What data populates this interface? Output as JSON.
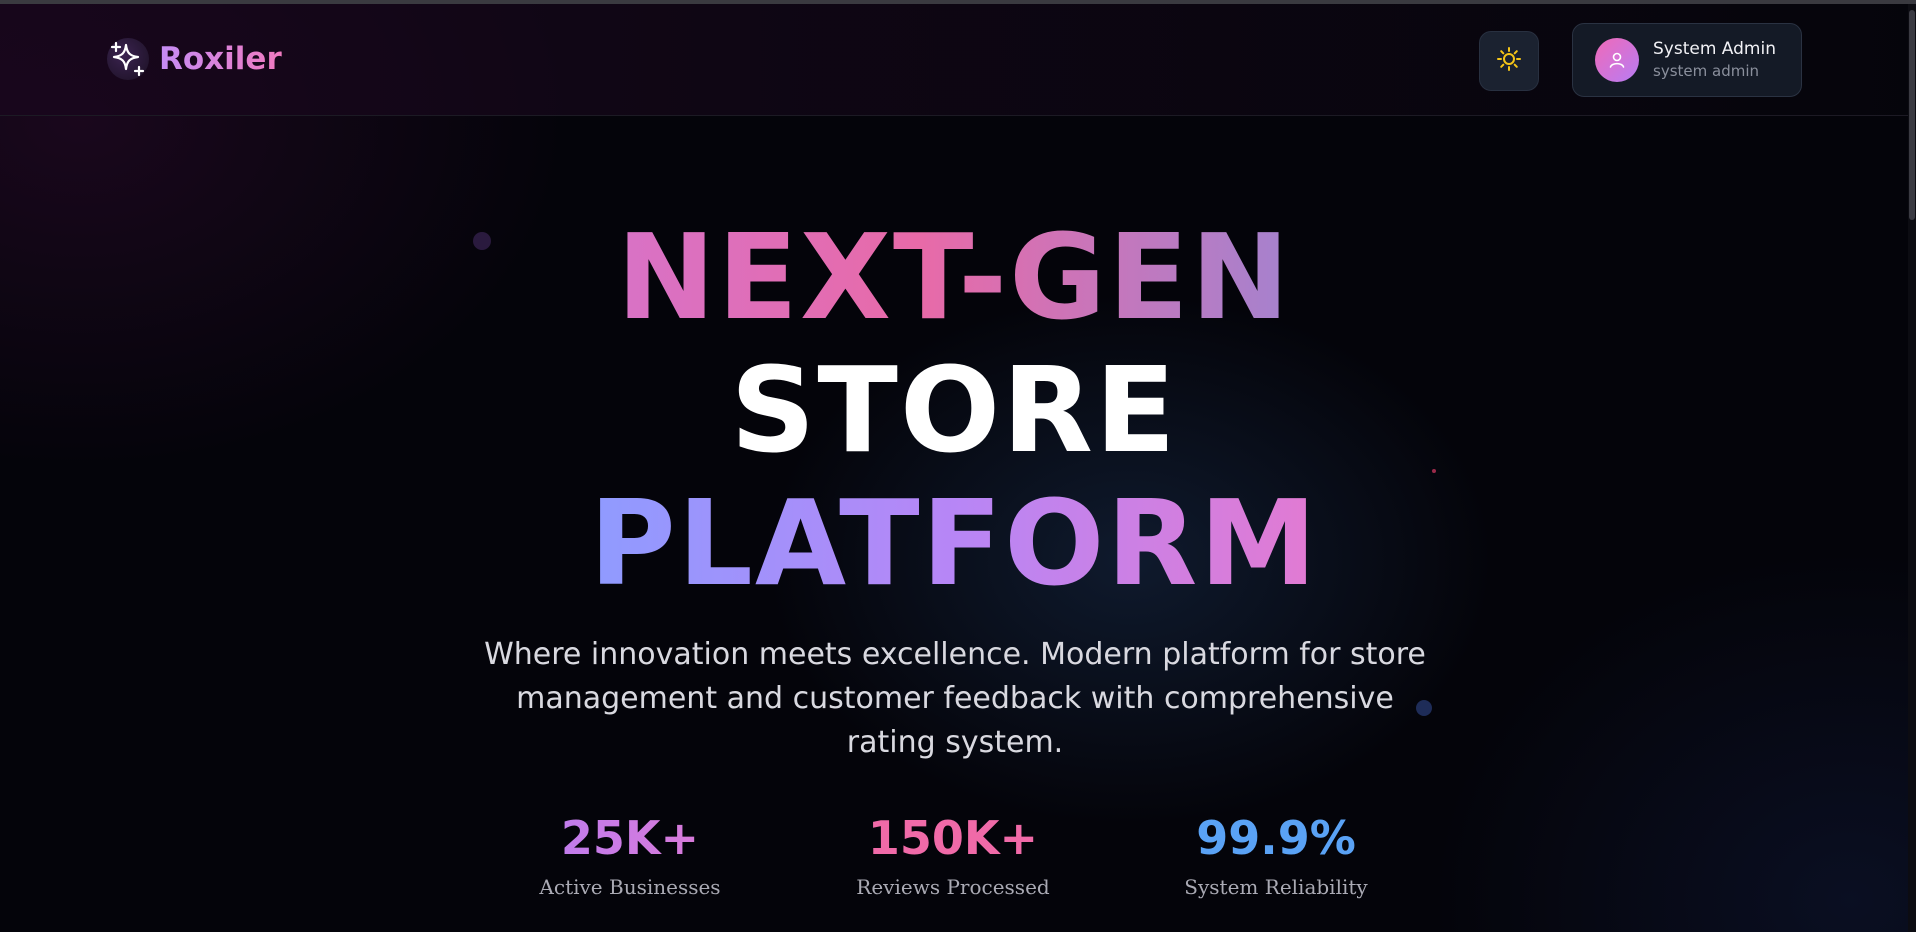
{
  "brand": {
    "name": "Roxiler"
  },
  "header": {
    "theme_toggle_icon": "sun-icon",
    "user": {
      "name": "System Admin",
      "role": "system admin",
      "avatar_icon": "user-icon"
    }
  },
  "hero": {
    "line1": "NEXT-GEN",
    "line2": "STORE",
    "line3": "PLATFORM",
    "subtitle": "Where innovation meets excellence. Modern platform for store management and customer feedback with comprehensive rating system."
  },
  "stats": [
    {
      "value": "25K+",
      "label": "Active Businesses",
      "color": "#c47af0"
    },
    {
      "value": "150K+",
      "label": "Reviews Processed",
      "color": "#f06aa8"
    },
    {
      "value": "99.9%",
      "label": "System Reliability",
      "color": "#5aa2f5"
    }
  ],
  "colors": {
    "background": "#05050a",
    "accent_pink": "#e86aa8",
    "accent_purple": "#b786f6",
    "accent_blue": "#8f9bff"
  }
}
